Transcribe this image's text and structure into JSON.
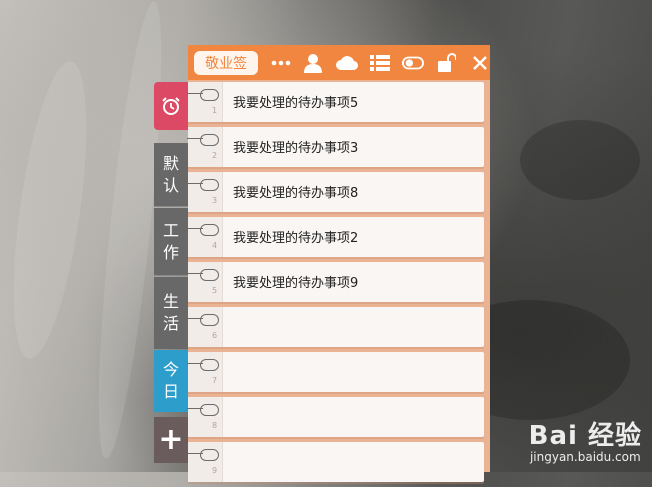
{
  "toolbar": {
    "brand": "敬业签",
    "icons": [
      "more-icon",
      "user-icon",
      "cloud-icon",
      "list-icon",
      "toggle-icon",
      "unlock-icon",
      "close-icon"
    ]
  },
  "sidebar": {
    "alarm_icon": "alarm-clock-icon",
    "tabs": [
      {
        "label": "默\n认",
        "line1": "默",
        "line2": "认"
      },
      {
        "label": "工\n作",
        "line1": "工",
        "line2": "作"
      },
      {
        "label": "生\n活",
        "line1": "生",
        "line2": "活"
      },
      {
        "label": "今\n日",
        "line1": "今",
        "line2": "日"
      }
    ],
    "add_label": "+"
  },
  "notes": [
    {
      "num": "1",
      "text": "我要处理的待办事项5"
    },
    {
      "num": "2",
      "text": "我要处理的待办事项3"
    },
    {
      "num": "3",
      "text": "我要处理的待办事项8"
    },
    {
      "num": "4",
      "text": "我要处理的待办事项2"
    },
    {
      "num": "5",
      "text": "我要处理的待办事项9"
    },
    {
      "num": "6",
      "text": ""
    },
    {
      "num": "7",
      "text": ""
    },
    {
      "num": "8",
      "text": ""
    },
    {
      "num": "9",
      "text": ""
    }
  ],
  "watermark": {
    "main": "Bai 经验",
    "sub": "jingyan.baidu.com"
  },
  "colors": {
    "accent": "#f08640",
    "alarm": "#dc4965",
    "today": "#2d9dcc",
    "tab": "#686868"
  }
}
